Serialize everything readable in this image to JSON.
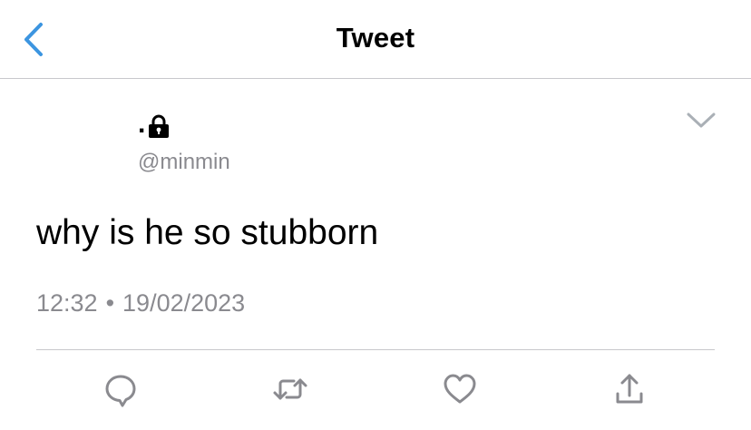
{
  "header": {
    "title": "Tweet",
    "back_icon": "chevron-left-icon",
    "accent_color": "#3c95e0"
  },
  "tweet": {
    "display_name": ".",
    "protected_icon": "lock-icon",
    "handle": "@minmin",
    "text": "why is he so stubborn",
    "time": "12:32",
    "separator": "•",
    "date": "19/02/2023",
    "more_icon": "chevron-down-icon"
  },
  "actions": [
    {
      "name": "reply",
      "icon": "reply-bubble-icon"
    },
    {
      "name": "retweet",
      "icon": "retweet-icon"
    },
    {
      "name": "like",
      "icon": "heart-icon"
    },
    {
      "name": "share",
      "icon": "share-icon"
    }
  ],
  "colors": {
    "secondary_text": "#8a8a8f",
    "divider": "#c8c8cc",
    "icon_gray": "#8a8a8f"
  }
}
